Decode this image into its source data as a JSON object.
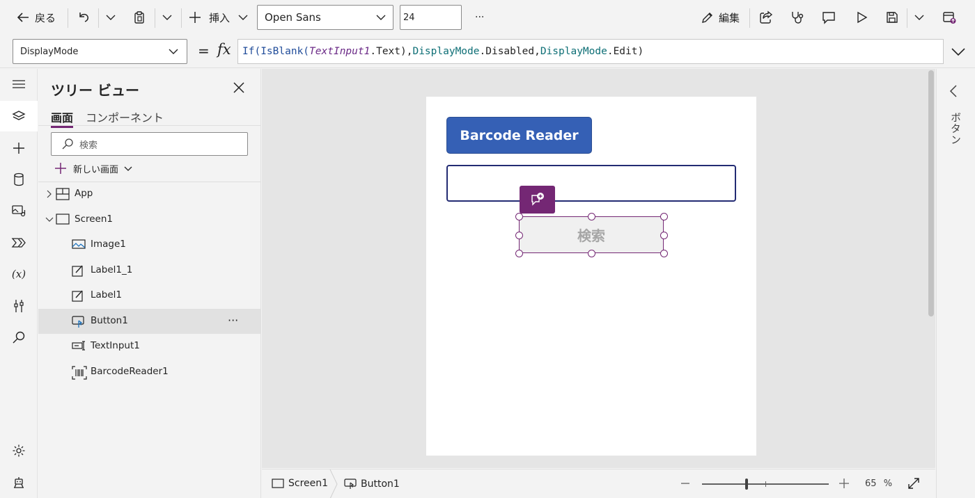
{
  "toolbar": {
    "back_label": "戻る",
    "insert_label": "挿入",
    "font_name": "Open Sans",
    "font_size": "24",
    "more_label": "···",
    "edit_label": "編集"
  },
  "formula_bar": {
    "property": "DisplayMode",
    "equals": "=",
    "fx": "fx",
    "formula_parts": [
      {
        "text": "If(",
        "kind": "fn"
      },
      {
        "text": "IsBlank(",
        "kind": "fn"
      },
      {
        "text": "TextInput1",
        "kind": "ctl"
      },
      {
        "text": ".Text),",
        "kind": "plain"
      },
      {
        "text": "DisplayMode",
        "kind": "enum"
      },
      {
        "text": ".Disabled,",
        "kind": "plain"
      },
      {
        "text": "DisplayMode",
        "kind": "enum"
      },
      {
        "text": ".Edit)",
        "kind": "plain"
      }
    ]
  },
  "tree": {
    "title": "ツリー ビュー",
    "tabs": [
      "画面",
      "コンポーネント"
    ],
    "search_placeholder": "検索",
    "new_screen_label": "新しい画面",
    "items": [
      {
        "label": "App",
        "icon": "app-icon",
        "level": 0,
        "expander": "collapsed"
      },
      {
        "label": "Screen1",
        "icon": "screen-icon",
        "level": 0,
        "expander": "expanded"
      },
      {
        "label": "Image1",
        "icon": "image-icon",
        "level": 1
      },
      {
        "label": "Label1_1",
        "icon": "label-icon",
        "level": 1
      },
      {
        "label": "Label1",
        "icon": "label-icon",
        "level": 1
      },
      {
        "label": "Button1",
        "icon": "button-icon",
        "level": 1,
        "selected": true,
        "more": "···"
      },
      {
        "label": "TextInput1",
        "icon": "textinput-icon",
        "level": 1
      },
      {
        "label": "BarcodeReader1",
        "icon": "barcode-icon",
        "level": 1
      }
    ]
  },
  "canvas": {
    "barcode_button_label": "Barcode Reader",
    "search_button_label": "検索"
  },
  "statusbar": {
    "breadcrumb": [
      "Screen1",
      "Button1"
    ],
    "zoom_value": "65",
    "zoom_unit": "%",
    "zoom_fraction": 0.35
  },
  "right_pane": {
    "vertical_label": "ボタン"
  },
  "colors": {
    "accent_purple": "#742774",
    "barcode_button": "#3560b5",
    "input_border": "#232b73",
    "disabled_button_bg": "#f0f0f0",
    "disabled_button_text": "#a6a6a6"
  }
}
